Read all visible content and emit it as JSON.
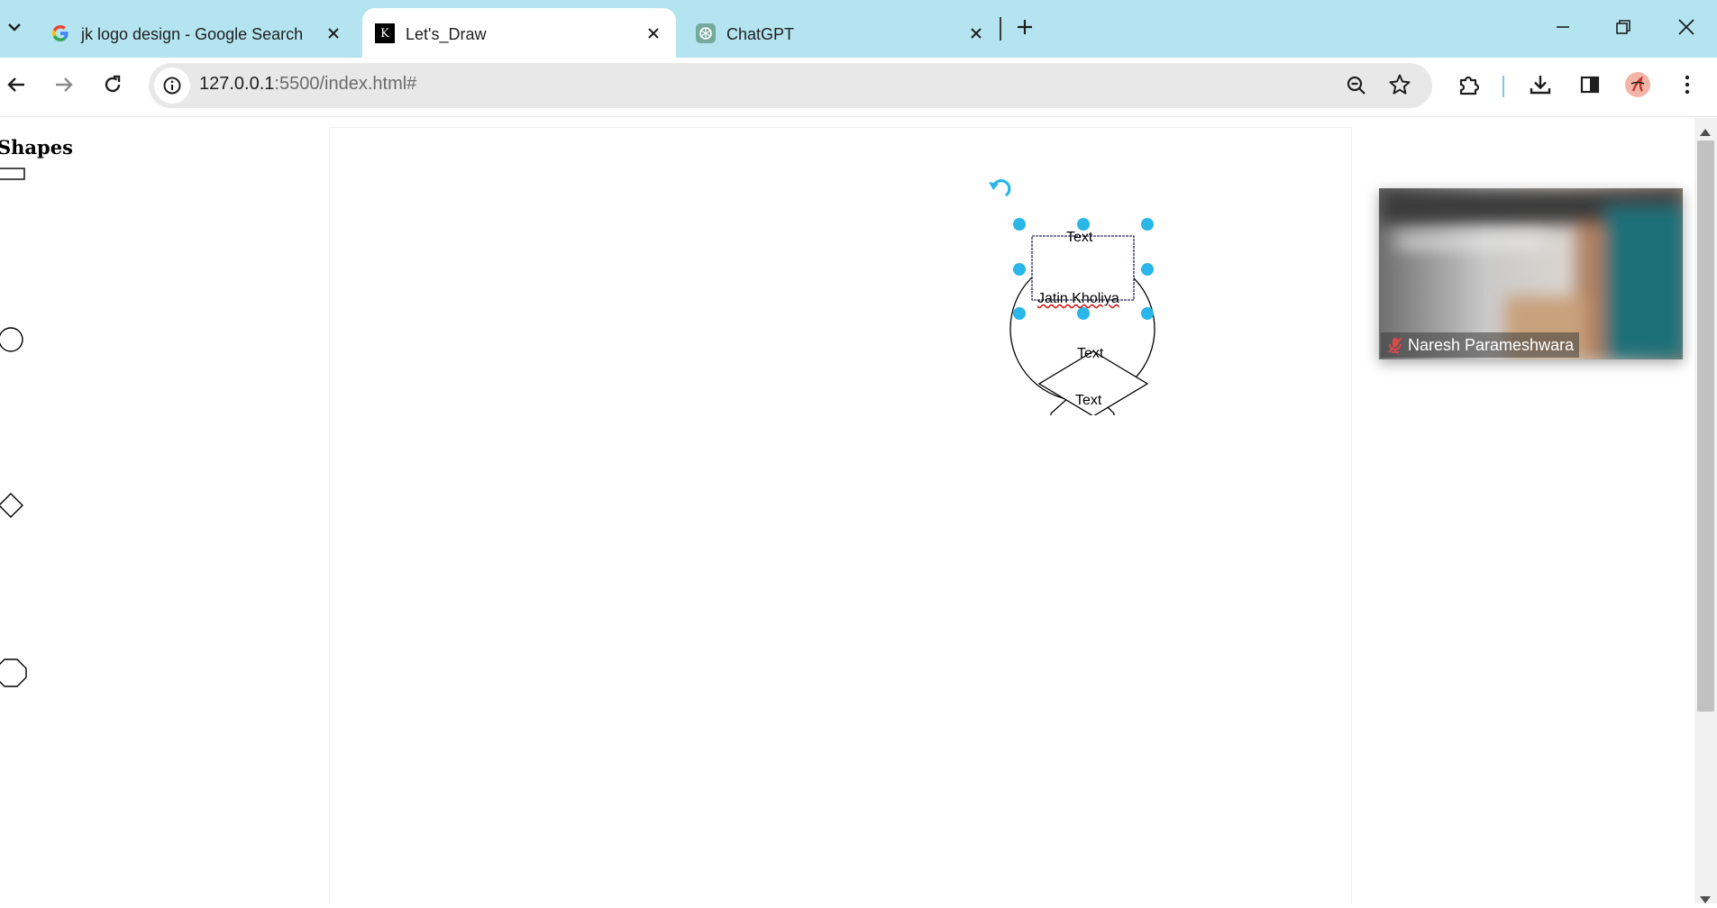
{
  "browser": {
    "tabs": [
      {
        "title": "jk logo design - Google Search",
        "favicon": "google-g-icon",
        "active": false
      },
      {
        "title": "Let's_Draw",
        "favicon": "k-logo-icon",
        "favicon_text": "K",
        "active": true
      },
      {
        "title": "ChatGPT",
        "favicon": "chatgpt-icon",
        "active": false
      }
    ],
    "url": {
      "host": "127.0.0.1",
      "rest": ":5500/index.html#"
    }
  },
  "sidebar": {
    "title": "Shapes",
    "items": [
      "rectangle-shape",
      "circle-shape",
      "diamond-shape",
      "octagon-shape"
    ]
  },
  "canvas": {
    "rect_text": "Text",
    "circle_text": "Jatin Kholiya",
    "diamond_text": "Text",
    "octagon_text": "Text",
    "selection_color": "#29b6e8"
  },
  "video": {
    "participant": "Naresh Parameshwara",
    "muted": true
  },
  "colors": {
    "tabstrip": "#b4e4f0",
    "omnibox": "#e8e8e8",
    "mic_muted": "#e04848"
  }
}
